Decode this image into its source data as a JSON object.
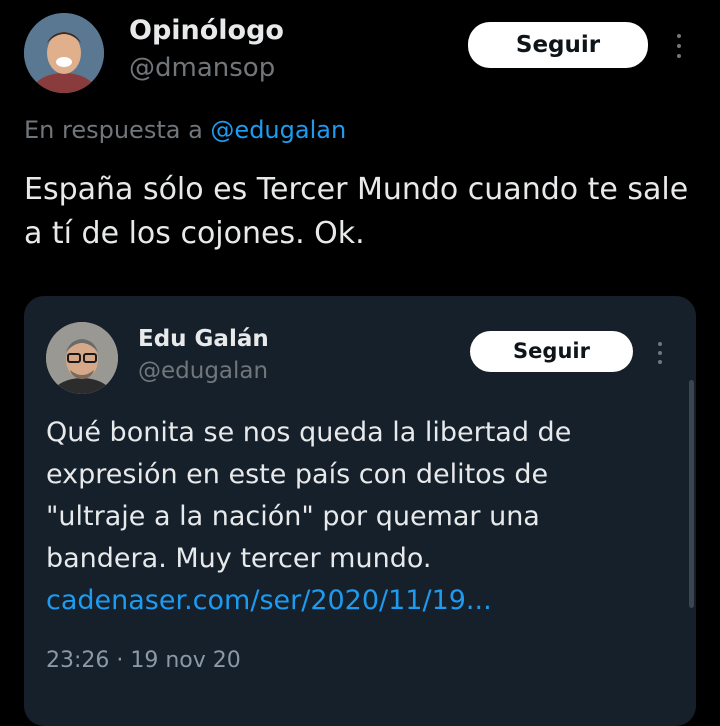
{
  "tweet": {
    "author_name": "Opinólogo",
    "author_handle": "@dmansop",
    "follow_label": "Seguir",
    "reply_prefix": "En respuesta a",
    "reply_to": "@edugalan",
    "text": "España sólo es Tercer Mundo cuando te sale a tí de los cojones. Ok."
  },
  "quoted_tweet": {
    "author_name": "Edu Galán",
    "author_handle": "@edugalan",
    "follow_label": "Seguir",
    "text": "Qué bonita se nos queda la libertad de expresión en este país con delitos de \"ultraje a la nación\" por quemar una bandera. Muy tercer mundo.",
    "link": "cadenaser.com/ser/2020/11/19...",
    "timestamp": "23:26 · 19 nov 20"
  },
  "icons": {
    "more": "more-options-icon"
  },
  "colors": {
    "background": "#000000",
    "card_background": "#15202b",
    "link": "#1d9bf0",
    "secondary_text": "#71767b",
    "button_bg": "#ffffff"
  }
}
